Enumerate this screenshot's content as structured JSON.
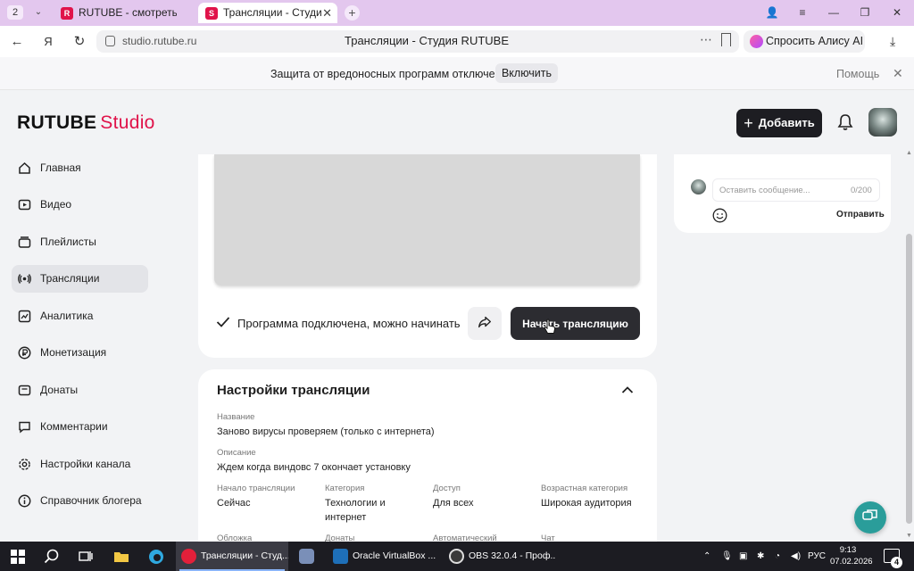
{
  "browser": {
    "tab_count": "2",
    "tabs": [
      {
        "title": "RUTUBE - смотреть виде",
        "favicon": "R"
      },
      {
        "title": "Трансляции - Студия R",
        "favicon": "S"
      }
    ],
    "url": "studio.rutube.ru",
    "page_title": "Трансляции - Студия RUTUBE",
    "alice_label": "Спросить Алису AI",
    "colors": {
      "tabbar": "#e3c7ee",
      "accent": "#e0134a"
    }
  },
  "infobar": {
    "message": "Защита от вредоносных программ отключена",
    "enable_label": "Включить",
    "help_label": "Помощь"
  },
  "header": {
    "logo_main": "RUTUBE",
    "logo_studio": "Studio",
    "add_label": "Добавить"
  },
  "sidebar": {
    "items": [
      {
        "label": "Главная",
        "icon": "home-icon"
      },
      {
        "label": "Видео",
        "icon": "video-icon"
      },
      {
        "label": "Плейлисты",
        "icon": "playlist-icon"
      },
      {
        "label": "Трансляции",
        "icon": "broadcast-icon",
        "active": true
      },
      {
        "label": "Аналитика",
        "icon": "analytics-icon"
      },
      {
        "label": "Монетизация",
        "icon": "ruble-icon"
      },
      {
        "label": "Донаты",
        "icon": "donate-icon"
      },
      {
        "label": "Комментарии",
        "icon": "comment-icon"
      },
      {
        "label": "Настройки канала",
        "icon": "gear-icon"
      },
      {
        "label": "Справочник блогера",
        "icon": "info-icon"
      }
    ]
  },
  "stream": {
    "status_text": "Программа подключена, можно начинать",
    "start_label": "Начать трансляцию"
  },
  "settings": {
    "title": "Настройки трансляции",
    "name_label": "Название",
    "name_value": "Заново вирусы проверяем (только с интернета)",
    "desc_label": "Описание",
    "desc_value": "Ждем когда виндовс 7 окончает установку",
    "start_label": "Начало трансляции",
    "start_value": "Сейчас",
    "category_label": "Категория",
    "category_value": "Технологии и интернет",
    "access_label": "Доступ",
    "access_value": "Для всех",
    "age_label": "Возрастная категория",
    "age_value": "Широкая аудитория",
    "cover_label": "Обложка",
    "donations_label": "Донаты",
    "auto_label": "Автоматический",
    "chat_label": "Чат"
  },
  "chat": {
    "placeholder": "Оставить сообщение...",
    "counter": "0/200",
    "send_label": "Отправить"
  },
  "taskbar": {
    "apps": [
      {
        "label": "Трансляции - Студ...",
        "active": true
      },
      {
        "label": "",
        "active": false
      },
      {
        "label": "Oracle VirtualBox ...",
        "active": false
      },
      {
        "label": "OBS 32.0.4 - Проф...",
        "active": false
      }
    ],
    "lang": "РУС",
    "time": "9:13",
    "date": "07.02.2026",
    "notifications": "4"
  }
}
